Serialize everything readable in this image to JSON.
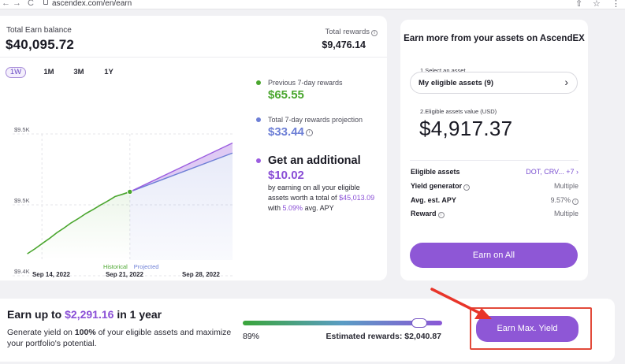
{
  "browser": {
    "back": "←",
    "forward": "→",
    "reload": "C",
    "url": "ascendex.com/en/earn",
    "share": "⇧",
    "star": "☆",
    "menu": "⋮"
  },
  "balance": {
    "label": "Total Earn balance",
    "value": "$40,095.72",
    "rewards_label": "Total rewards",
    "rewards_value": "$9,476.14"
  },
  "tabs": [
    "1W",
    "1M",
    "3M",
    "1Y"
  ],
  "active_tab": "1W",
  "chart_data": {
    "type": "line",
    "x_ticks": [
      "Sep 14, 2022",
      "Sep 21, 2022",
      "Sep 28, 2022"
    ],
    "y_ticks": [
      "$9.5K",
      "$9.5K",
      "$9.4K"
    ],
    "series": [
      {
        "name": "Historical",
        "color": "#4aa62e",
        "x": [
          0,
          1,
          2,
          3,
          4,
          5,
          6,
          7
        ],
        "y": [
          9.4,
          9.413,
          9.427,
          9.44,
          9.452,
          9.463,
          9.474,
          9.48
        ]
      },
      {
        "name": "Projected",
        "color": "#6d7fd6",
        "x": [
          7,
          14
        ],
        "y": [
          9.48,
          9.53
        ]
      },
      {
        "name": "",
        "color": "#9b5de0",
        "x": [
          7,
          14
        ],
        "y": [
          9.48,
          9.543
        ]
      }
    ],
    "ylim": [
      9.392,
      9.575
    ],
    "xlim": [
      -1,
      14
    ]
  },
  "summary": {
    "prev_label": "Previous 7-day rewards",
    "prev_value": "$65.55",
    "proj_label": "Total 7-day rewards projection",
    "proj_value": "$33.44",
    "add_title": "Get an additional",
    "add_value": "$10.02",
    "add_text_1": "by earning on all your eligible assets worth a total of",
    "add_amount": "$45,013.09",
    "add_text_2": "with",
    "add_apy": "5.09%",
    "add_text_3": "avg. APY",
    "colors": {
      "prev": "#4aa62e",
      "proj": "#6d7fd6",
      "add": "#9b5de0"
    }
  },
  "right_panel": {
    "title": "Earn more from your assets on AscendEX",
    "select_label": "1.Select an asset",
    "select_value": "My eligible assets (9)",
    "value_label": "2.Eligible assets value (USD)",
    "value": "$4,917.37",
    "rows": [
      {
        "key": "Eligible assets",
        "value": "DOT, CRV... +7 ›"
      },
      {
        "key": "Yield generator",
        "value": "Multiple"
      },
      {
        "key": "Avg. est. APY",
        "value": "9.57%"
      },
      {
        "key": "Reward",
        "value": "Multiple"
      }
    ],
    "button": "Earn on All"
  },
  "bottom": {
    "headline_1": "Earn up to",
    "headline_amount": "$2,291.16",
    "headline_2": "in 1 year",
    "sub_1": "Generate yield on",
    "sub_pct": "100%",
    "sub_2": "of your eligible assets and maximize your portfolio's potential.",
    "slider_pct": "89%",
    "slider_fraction": 0.89,
    "est_rewards": "Estimated rewards: $2,040.87",
    "button": "Earn Max. Yield"
  }
}
